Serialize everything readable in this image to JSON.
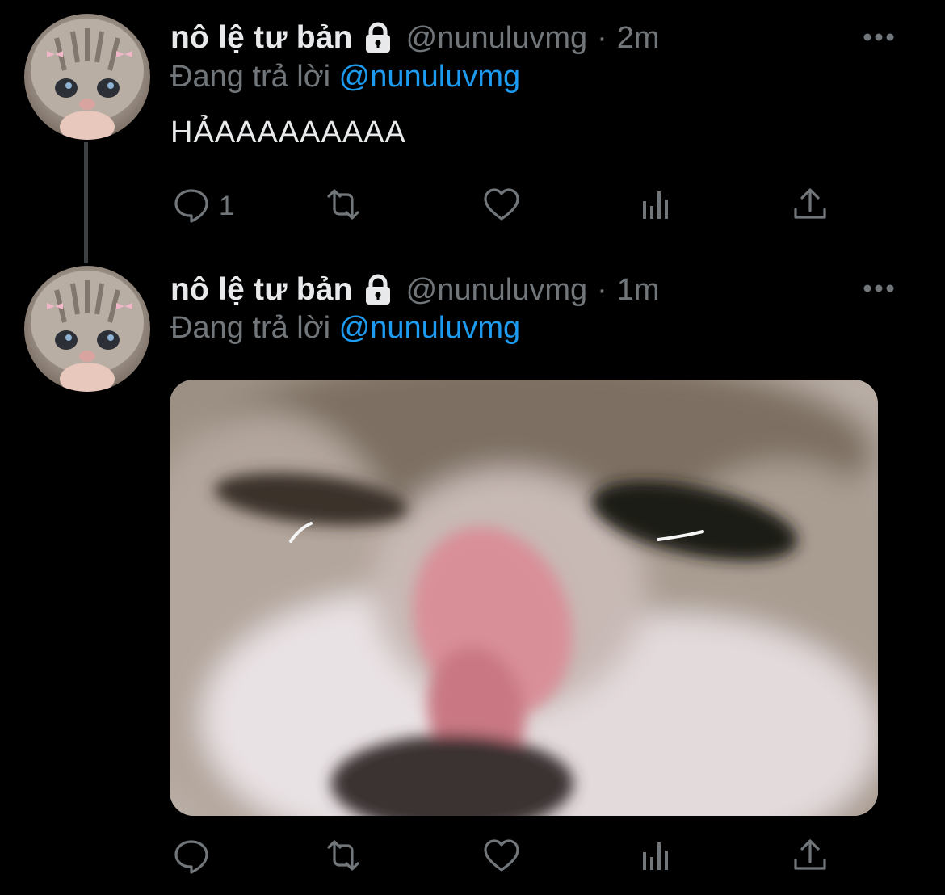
{
  "tweets": [
    {
      "display_name": "nô lệ tư bản",
      "handle": "@nunuluvmg",
      "separator": "·",
      "time": "2m",
      "reply_prefix": "Đang trả lời",
      "reply_to": "@nunuluvmg",
      "text": "HẢAAAAAAAAA",
      "reply_count": "1",
      "icons": [
        "lock-icon",
        "more-icon",
        "reply-icon",
        "retweet-icon",
        "like-icon",
        "analytics-icon",
        "share-icon"
      ]
    },
    {
      "display_name": "nô lệ tư bản",
      "handle": "@nunuluvmg",
      "separator": "·",
      "time": "1m",
      "reply_prefix": "Đang trả lời",
      "reply_to": "@nunuluvmg",
      "reply_count": "",
      "icons": [
        "lock-icon",
        "more-icon",
        "reply-icon",
        "retweet-icon",
        "like-icon",
        "analytics-icon",
        "share-icon"
      ]
    }
  ],
  "colors": {
    "background": "#000000",
    "primary_text": "#e7e9ea",
    "secondary_text": "#71767b",
    "accent": "#1d9bf0",
    "thread_line": "#3e4144"
  }
}
